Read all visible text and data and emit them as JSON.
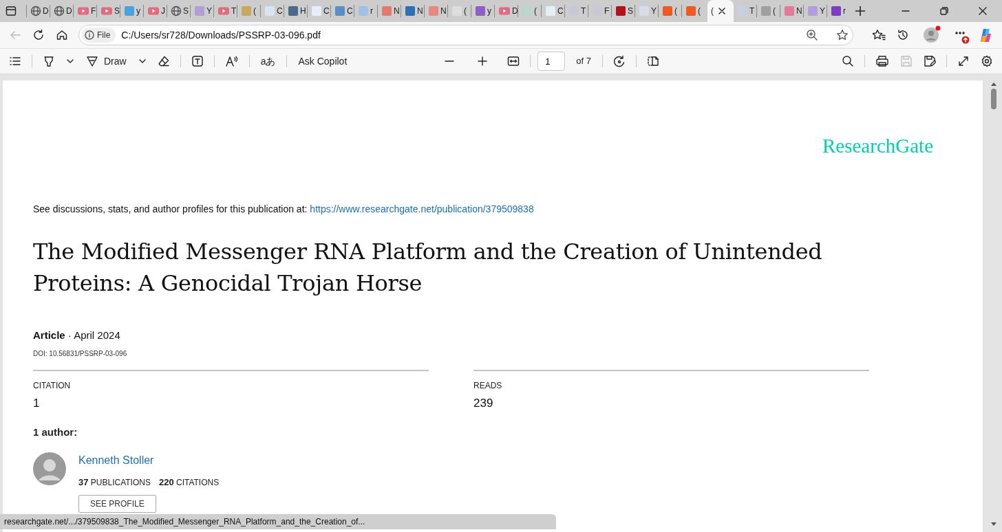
{
  "browser_tabs": [
    {
      "label": "D",
      "kind": "globe",
      "selected": false
    },
    {
      "label": "D",
      "kind": "globe",
      "selected": false
    },
    {
      "label": "F",
      "kind": "video",
      "selected": false
    },
    {
      "label": "S",
      "kind": "video",
      "selected": false
    },
    {
      "label": "y",
      "kind": "square",
      "color": "#4aa3df",
      "selected": false
    },
    {
      "label": "J",
      "kind": "video",
      "selected": false
    },
    {
      "label": "S",
      "kind": "globe",
      "selected": false
    },
    {
      "label": "Y",
      "kind": "square",
      "color": "#b39ddb",
      "selected": false
    },
    {
      "label": "T",
      "kind": "video",
      "selected": false
    },
    {
      "label": "(",
      "kind": "square",
      "color": "#c8a860",
      "selected": false
    },
    {
      "label": "C",
      "kind": "square",
      "color": "#d6e6ec",
      "selected": false
    },
    {
      "label": "H",
      "kind": "square",
      "color": "#4a6a8a",
      "selected": false
    },
    {
      "label": "C",
      "kind": "square",
      "color": "#e8eef8",
      "selected": false
    },
    {
      "label": "C",
      "kind": "square",
      "color": "#5b8ec4",
      "selected": false
    },
    {
      "label": "r",
      "kind": "square",
      "color": "#9fc3e6",
      "selected": false
    },
    {
      "label": "N",
      "kind": "square",
      "color": "#e07b6e",
      "selected": false
    },
    {
      "label": "N",
      "kind": "square",
      "color": "#2f6fb4",
      "selected": false
    },
    {
      "label": "N",
      "kind": "square",
      "color": "#e58a7c",
      "selected": false
    },
    {
      "label": "(",
      "kind": "square",
      "color": "#dddddd",
      "selected": false
    },
    {
      "label": "y",
      "kind": "square",
      "color": "#8e5fc7",
      "selected": false
    },
    {
      "label": "D",
      "kind": "video",
      "selected": false
    },
    {
      "label": "(",
      "kind": "square",
      "color": "#b9d6cf",
      "selected": false
    },
    {
      "label": "C",
      "kind": "square",
      "color": "#e8eef8",
      "selected": false
    },
    {
      "label": "T",
      "kind": "square",
      "color": "#c9c9d6",
      "selected": false
    },
    {
      "label": "F",
      "kind": "square",
      "color": "#c9c9d6",
      "selected": false
    },
    {
      "label": "S",
      "kind": "square",
      "color": "#b3121b",
      "selected": false
    },
    {
      "label": "Y",
      "kind": "square",
      "color": "#d9dce6",
      "selected": false
    },
    {
      "label": "(",
      "kind": "square",
      "color": "#f05a22",
      "selected": false
    },
    {
      "label": "(",
      "kind": "square",
      "color": "#f05a22",
      "selected": false
    },
    {
      "label": "(",
      "kind": "none",
      "selected": true
    },
    {
      "label": "T",
      "kind": "square",
      "color": "#c8cfe0",
      "selected": false
    },
    {
      "label": "(",
      "kind": "square",
      "color": "#a0a0a0",
      "selected": false
    },
    {
      "label": "N",
      "kind": "square",
      "color": "#e27a9c",
      "selected": false
    },
    {
      "label": "Y",
      "kind": "square",
      "color": "#b39ddb",
      "selected": false
    },
    {
      "label": "r",
      "kind": "square",
      "color": "#7b3fc4",
      "selected": false
    }
  ],
  "navigation": {
    "back_disabled": true
  },
  "address_bar": {
    "scheme_chip": "File",
    "url": "C:/Users/sr728/Downloads/PSSRP-03-096.pdf"
  },
  "profile": {
    "alert": true
  },
  "more_menu": {
    "update_badge": true
  },
  "pdf_toolbar": {
    "draw_label": "Draw",
    "translate_label": "aあ",
    "copilot_label": "Ask Copilot",
    "page_number": "1",
    "page_count": "of 7",
    "save_disabled": true
  },
  "document": {
    "logo": "ResearchGate",
    "intro": "See discussions, stats, and author profiles for this publication at:",
    "intro_link": "https://www.researchgate.net/publication/379509838",
    "title_lines": [
      "The Modified Messenger RNA Platform and the Creation of Unintended",
      "Proteins: A Genocidal Trojan Horse"
    ],
    "meta": "**Article** · April 2024",
    "doi": "DOI: 10.56831/PSSRP-03-096",
    "stats": [
      {
        "label": "CITATION",
        "value": "1"
      },
      {
        "label": "READS",
        "value": "239"
      }
    ],
    "authors_heading": "1 author:",
    "authors": [
      {
        "name": "Kenneth Stoller",
        "publications": "**37** PUBLICATIONS",
        "citations": "**220** CITATIONS",
        "button": "SEE PROFILE"
      }
    ]
  },
  "status_bar": "researchgate.net/.../379509838_The_Modified_Messenger_RNA_Platform_and_the_Creation_of..."
}
